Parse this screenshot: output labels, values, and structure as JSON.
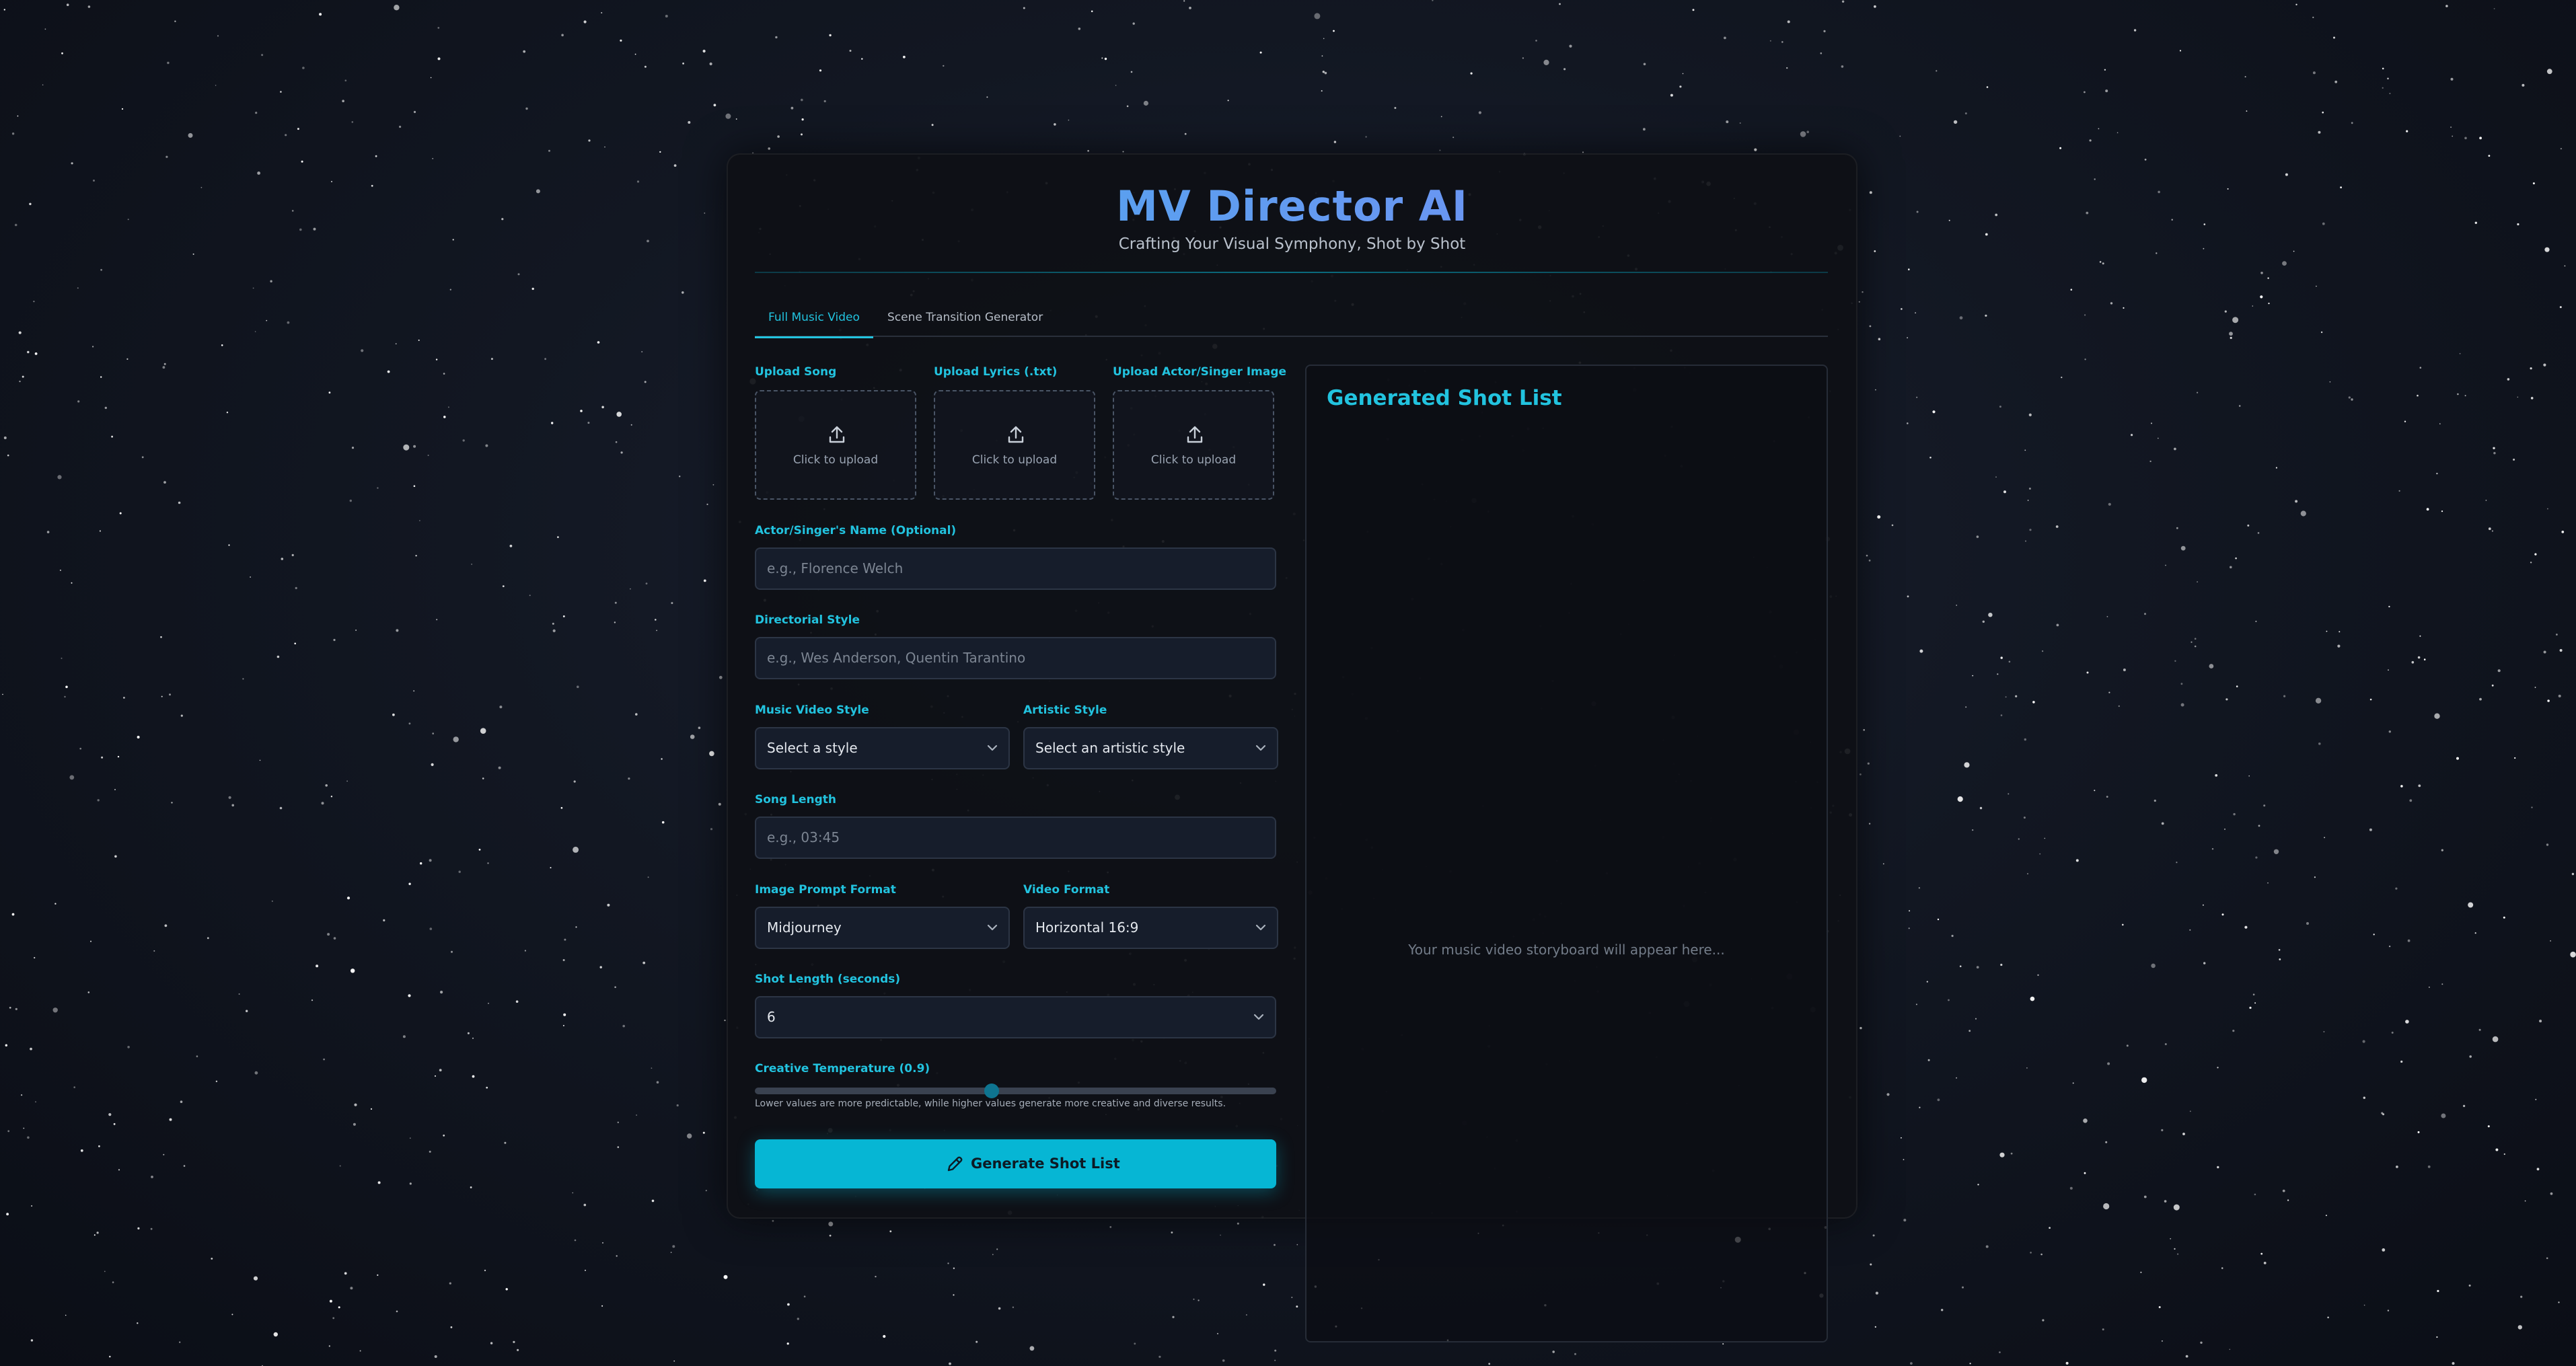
{
  "app": {
    "title": "MV Director AI",
    "subtitle": "Crafting Your Visual Symphony, Shot by Shot"
  },
  "tabs": [
    {
      "label": "Full Music Video",
      "active": true
    },
    {
      "label": "Scene Transition Generator",
      "active": false
    }
  ],
  "uploads": [
    {
      "label": "Upload Song",
      "text": "Click to upload",
      "icon": "upload-icon"
    },
    {
      "label": "Upload Lyrics (.txt)",
      "text": "Click to upload",
      "icon": "upload-icon"
    },
    {
      "label": "Upload Actor/Singer Image",
      "text": "Click to upload",
      "icon": "upload-icon"
    }
  ],
  "form": {
    "actor_name": {
      "label": "Actor/Singer's Name (Optional)",
      "placeholder": "e.g., Florence Welch",
      "value": ""
    },
    "directorial_style": {
      "label": "Directorial Style",
      "placeholder": "e.g., Wes Anderson, Quentin Tarantino",
      "value": ""
    },
    "music_video_style": {
      "label": "Music Video Style",
      "selected": "Select a style"
    },
    "artistic_style": {
      "label": "Artistic Style",
      "selected": "Select an artistic style"
    },
    "song_length": {
      "label": "Song Length",
      "placeholder": "e.g., 03:45",
      "value": ""
    },
    "image_prompt_format": {
      "label": "Image Prompt Format",
      "selected": "Midjourney"
    },
    "video_format": {
      "label": "Video Format",
      "selected": "Horizontal 16:9"
    },
    "shot_length": {
      "label": "Shot Length (seconds)",
      "selected": "6"
    },
    "creative_temperature": {
      "label": "Creative Temperature (0.9)",
      "value": 0.9,
      "helper": "Lower values are more predictable, while higher values generate more creative and diverse results."
    },
    "generate_button": {
      "label": "Generate Shot List",
      "icon": "pencil-icon"
    }
  },
  "output": {
    "title": "Generated Shot List",
    "empty_message": "Your music video storyboard will appear here..."
  },
  "colors": {
    "accent": "#22c3df",
    "button": "#06b6d4",
    "title_gradient_start": "#4aa9ec",
    "title_gradient_end": "#7a8cf5",
    "background": "#121722"
  }
}
